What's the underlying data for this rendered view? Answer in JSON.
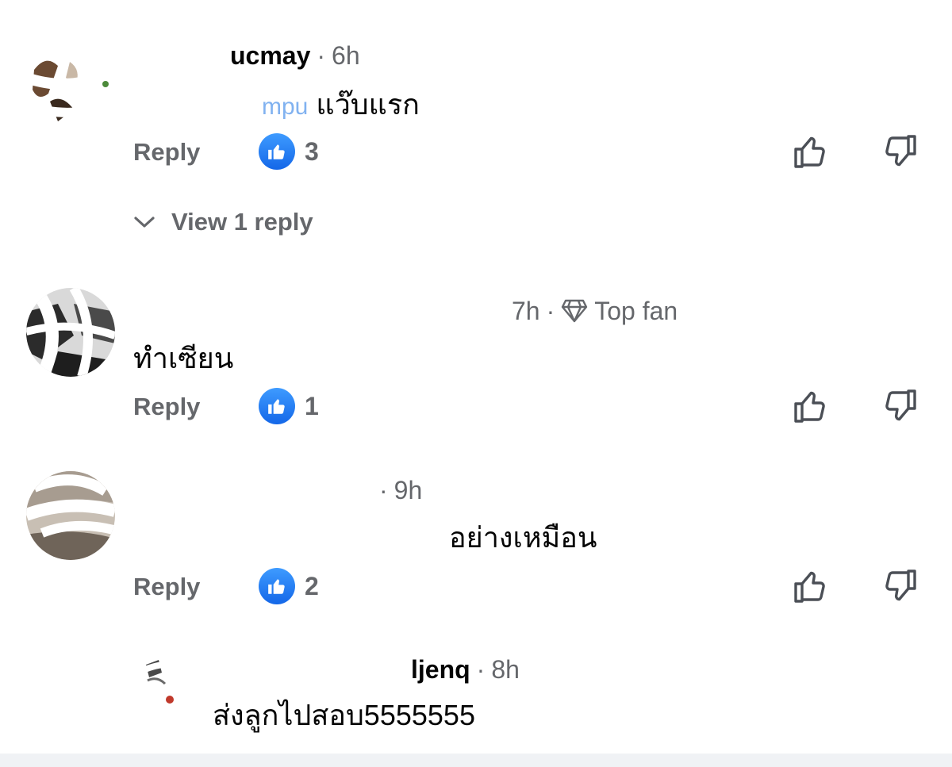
{
  "colors": {
    "secondary_text": "#65676b",
    "primary_text": "#050505",
    "mention_blue": "#1b74e4",
    "like_blue": "#1877f2"
  },
  "icons": {
    "like_badge": "thumbs-up-icon",
    "upvote": "thumb-up-outline-icon",
    "downvote": "thumb-down-outline-icon",
    "expand": "chevron-down-icon",
    "badge": "diamond-icon"
  },
  "comments": [
    {
      "author_visible": "ucmay",
      "time": "6h",
      "mention_visible": "mpu",
      "text": "แว๊บแรก",
      "reply_label": "Reply",
      "likes": "3",
      "view_replies": "View 1 reply"
    },
    {
      "time": "7h",
      "badge_label": "Top fan",
      "text": "ทำเซียน",
      "reply_label": "Reply",
      "likes": "1"
    },
    {
      "time": "9h",
      "text": "อย่างเหมือน",
      "reply_label": "Reply",
      "likes": "2"
    },
    {
      "author_visible": "ljenq",
      "time": "8h",
      "text": "ส่งลูกไปสอบ5555555"
    }
  ]
}
